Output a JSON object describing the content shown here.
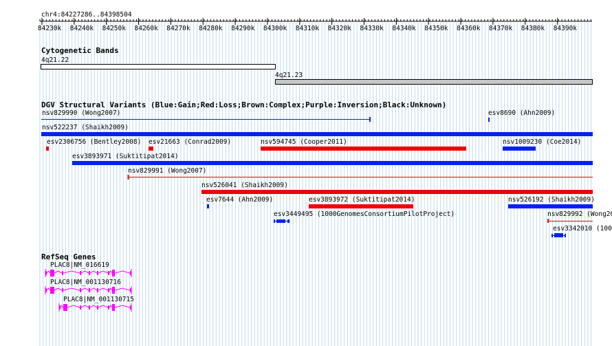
{
  "position": "chr4:84227286..84398504",
  "ruler_ticks": [
    "84230k",
    "84240k",
    "84250k",
    "84260k",
    "84270k",
    "84280k",
    "84290k",
    "84300k",
    "84310k",
    "84320k",
    "84330k",
    "84340k",
    "84350k",
    "84360k",
    "84370k",
    "84380k",
    "84390k"
  ],
  "tracks": {
    "cytoband_title": "Cytogenetic Bands",
    "band1": "4q21.22",
    "band2": "4q21.23",
    "dgv_title": "DGV Structural Variants (Blue:Gain;Red:Loss;Brown:Complex;Purple:Inversion;Black:Unknown)",
    "refseq_title": "RefSeq Genes"
  },
  "colors": {
    "gain": "#0022ee",
    "loss": "#ee0000",
    "gene": "#ff00ff",
    "grid": "#bfd9ef",
    "band_light": "#ffffff",
    "band_gray": "#c8c8c8"
  },
  "variants": [
    {
      "label": "nsv829990 (Wong2007)",
      "kind": "gain"
    },
    {
      "label": "esv8690 (Ahn2009)",
      "kind": "gain"
    },
    {
      "label": "nsv522237 (Shaikh2009)",
      "kind": "gain"
    },
    {
      "label": "esv2306756 (Bentley2008)",
      "kind": "loss"
    },
    {
      "label": "esv21663 (Conrad2009)",
      "kind": "loss"
    },
    {
      "label": "nsv594745 (Cooper2011)",
      "kind": "loss"
    },
    {
      "label": "nsv1009230 (Coe2014)",
      "kind": "gain"
    },
    {
      "label": "esv3893971 (Suktitipat2014)",
      "kind": "gain"
    },
    {
      "label": "nsv829991 (Wong2007)",
      "kind": "loss"
    },
    {
      "label": "nsv526041 (Shaikh2009)",
      "kind": "loss"
    },
    {
      "label": "esv7644 (Ahn2009)",
      "kind": "gain"
    },
    {
      "label": "esv3893972 (Suktitipat2014)",
      "kind": "loss"
    },
    {
      "label": "nsv526192 (Shaikh2009)",
      "kind": "gain"
    },
    {
      "label": "esv3449495 (1000GenomesConsortiumPilotProject)",
      "kind": "gain"
    },
    {
      "label": "nsv829992 (Wong20",
      "kind": "loss"
    },
    {
      "label": "esv3342010 (100",
      "kind": "gain"
    }
  ],
  "genes": [
    {
      "label": "PLAC8|NM_016619"
    },
    {
      "label": "PLAC8|NM_001130716"
    },
    {
      "label": "PLAC8|NM_001130715"
    }
  ]
}
